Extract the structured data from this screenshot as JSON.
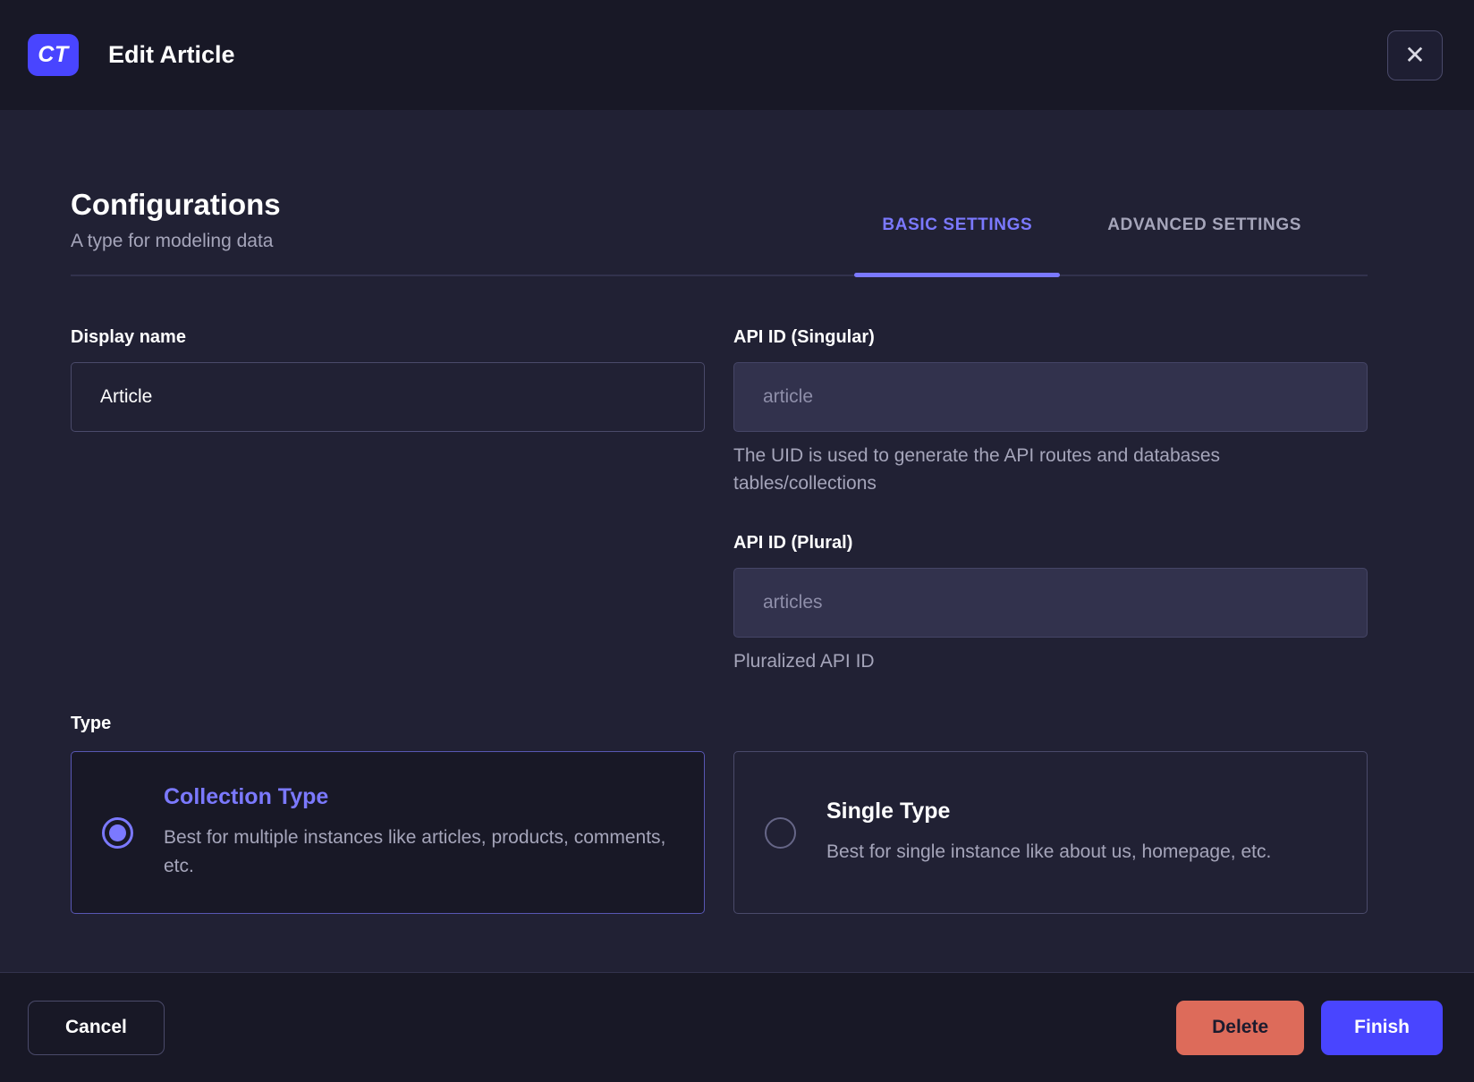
{
  "header": {
    "badge": "CT",
    "title": "Edit Article",
    "close_icon": "✕"
  },
  "configurations": {
    "title": "Configurations",
    "subtitle": "A type for modeling data",
    "tabs": [
      {
        "label": "BASIC SETTINGS",
        "active": true
      },
      {
        "label": "ADVANCED SETTINGS",
        "active": false
      }
    ]
  },
  "form": {
    "display_name": {
      "label": "Display name",
      "value": "Article"
    },
    "api_id_singular": {
      "label": "API ID (Singular)",
      "value": "article",
      "hint": "The UID is used to generate the API routes and databases tables/collections"
    },
    "api_id_plural": {
      "label": "API ID (Plural)",
      "value": "articles",
      "hint": "Pluralized API ID"
    },
    "type": {
      "label": "Type",
      "options": [
        {
          "title": "Collection Type",
          "description": "Best for multiple instances like articles, products, comments, etc.",
          "selected": true
        },
        {
          "title": "Single Type",
          "description": "Best for single instance like about us, homepage, etc.",
          "selected": false
        }
      ]
    }
  },
  "footer": {
    "cancel": "Cancel",
    "delete": "Delete",
    "finish": "Finish"
  },
  "colors": {
    "accent": "#4945ff",
    "accent_light": "#7b79ff",
    "danger": "#dd6b5a",
    "header_bg": "#181826",
    "body_bg": "#212134",
    "input_disabled_bg": "#32324d",
    "border": "#4a4a6a",
    "text_muted": "#a5a5ba"
  }
}
